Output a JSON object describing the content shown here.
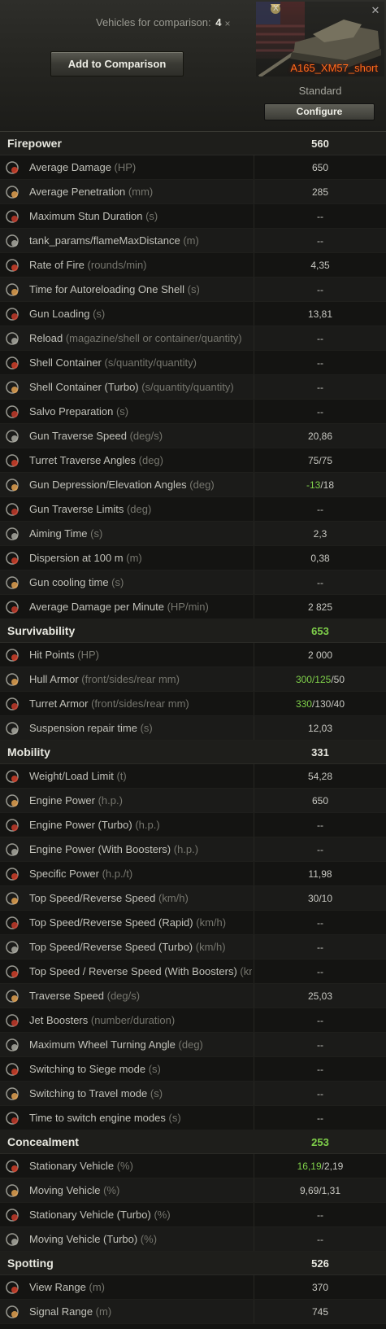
{
  "header": {
    "vehicles_label": "Vehicles for comparison:",
    "vehicles_count": "4",
    "close_symbol": "×",
    "add_button": "Add to Comparison"
  },
  "card": {
    "tier": "X",
    "name": "A165_XM57_short",
    "type": "Standard",
    "configure": "Configure",
    "close_symbol": "✕"
  },
  "colors": {
    "accent_green": "#7fd04a",
    "name_orange": "#ff6a1a"
  },
  "sections": [
    {
      "title": "Firepower",
      "value": "560",
      "value_color": "white",
      "rows": [
        {
          "label": "Average Damage ",
          "unit": "(HP)",
          "value": "650",
          "icon": "average-damage-icon",
          "green": true
        },
        {
          "label": "Average Penetration ",
          "unit": "(mm)",
          "value": "285",
          "icon": "penetration-icon",
          "green": true
        },
        {
          "label": "Maximum Stun Duration ",
          "unit": "(s)",
          "value": "--",
          "icon": "stun-icon"
        },
        {
          "label": "tank_params/flameMaxDistance ",
          "unit": "(m)",
          "value": "--",
          "icon": "flame-distance-icon"
        },
        {
          "label": "Rate of Fire ",
          "unit": "(rounds/min)",
          "value": "4,35",
          "icon": "rate-of-fire-icon"
        },
        {
          "label": "Time for Autoreloading One Shell ",
          "unit": "(s)",
          "value": "--",
          "icon": "autoreload-icon"
        },
        {
          "label": "Gun Loading ",
          "unit": "(s)",
          "value": "13,81",
          "icon": "gun-loading-icon"
        },
        {
          "label": "Reload ",
          "unit": "(magazine/shell or container/quantity)",
          "value": "--",
          "icon": "reload-icon"
        },
        {
          "label": "Shell Container ",
          "unit": "(s/quantity/quantity)",
          "value": "--",
          "icon": "shell-container-icon"
        },
        {
          "label": "Shell Container (Turbo) ",
          "unit": "(s/quantity/quantity)",
          "value": "--",
          "icon": "shell-container-turbo-icon"
        },
        {
          "label": "Salvo Preparation ",
          "unit": "(s)",
          "value": "--",
          "icon": "salvo-icon"
        },
        {
          "label": "Gun Traverse Speed ",
          "unit": "(deg/s)",
          "value": "20,86",
          "icon": "gun-traverse-icon"
        },
        {
          "label": "Turret Traverse Angles ",
          "unit": "(deg)",
          "value": "75/75",
          "icon": "turret-angles-icon",
          "green": true
        },
        {
          "label": "Gun Depression/Elevation Angles ",
          "unit": "(deg)",
          "value_parts": [
            "-13",
            "/18"
          ],
          "icon": "gun-elevation-icon"
        },
        {
          "label": "Gun Traverse Limits ",
          "unit": "(deg)",
          "value": "--",
          "icon": "traverse-limits-icon"
        },
        {
          "label": "Aiming Time ",
          "unit": "(s)",
          "value": "2,3",
          "icon": "aiming-icon"
        },
        {
          "label": "Dispersion at 100 m ",
          "unit": "(m)",
          "value": "0,38",
          "icon": "dispersion-icon"
        },
        {
          "label": "Gun cooling time ",
          "unit": "(s)",
          "value": "--",
          "icon": "gun-cooling-icon"
        },
        {
          "label": "Average Damage per Minute ",
          "unit": "(HP/min)",
          "value": "2 825",
          "icon": "dpm-icon"
        }
      ]
    },
    {
      "title": "Survivability",
      "value": "653",
      "value_color": "green",
      "rows": [
        {
          "label": "Hit Points ",
          "unit": "(HP)",
          "value": "2 000",
          "icon": "hit-points-icon",
          "green": true
        },
        {
          "label": "Hull Armor ",
          "unit": "(front/sides/rear mm)",
          "value_parts": [
            "300/125",
            "/50"
          ],
          "icon": "hull-armor-icon"
        },
        {
          "label": "Turret Armor ",
          "unit": "(front/sides/rear mm)",
          "value_parts": [
            "330",
            "/130/40"
          ],
          "icon": "turret-armor-icon"
        },
        {
          "label": "Suspension repair time ",
          "unit": "(s)",
          "value": "12,03",
          "icon": "suspension-repair-icon",
          "green": true
        }
      ]
    },
    {
      "title": "Mobility",
      "value": "331",
      "value_color": "white",
      "rows": [
        {
          "label": "Weight/Load Limit ",
          "unit": "(t)",
          "value": "54,28",
          "icon": "weight-icon",
          "green": true
        },
        {
          "label": "Engine Power ",
          "unit": "(h.p.)",
          "value": "650",
          "icon": "engine-power-icon"
        },
        {
          "label": "Engine Power (Turbo) ",
          "unit": "(h.p.)",
          "value": "--",
          "icon": "engine-turbo-icon"
        },
        {
          "label": "Engine Power (With Boosters) ",
          "unit": "(h.p.)",
          "value": "--",
          "icon": "engine-boosters-icon"
        },
        {
          "label": "Specific Power ",
          "unit": "(h.p./t)",
          "value": "11,98",
          "icon": "specific-power-icon"
        },
        {
          "label": "Top Speed/Reverse Speed ",
          "unit": "(km/h)",
          "value": "30/10",
          "icon": "top-speed-icon"
        },
        {
          "label": "Top Speed/Reverse Speed (Rapid) ",
          "unit": "(km/h)",
          "value": "--",
          "icon": "speed-rapid-icon"
        },
        {
          "label": "Top Speed/Reverse Speed (Turbo) ",
          "unit": "(km/h)",
          "value": "--",
          "icon": "speed-turbo-icon"
        },
        {
          "label": "Top Speed / Reverse Speed (With Boosters) ",
          "unit": "(km/h)",
          "value": "--",
          "icon": "speed-boosters-icon"
        },
        {
          "label": "Traverse Speed ",
          "unit": "(deg/s)",
          "value": "25,03",
          "icon": "traverse-speed-icon"
        },
        {
          "label": "Jet Boosters ",
          "unit": "(number/duration)",
          "value": "--",
          "icon": "jet-boosters-icon"
        },
        {
          "label": "Maximum Wheel Turning Angle ",
          "unit": "(deg)",
          "value": "--",
          "icon": "wheel-angle-icon"
        },
        {
          "label": "Switching to Siege mode  ",
          "unit": "(s)",
          "value": "--",
          "icon": "siege-mode-icon"
        },
        {
          "label": "Switching to Travel mode  ",
          "unit": "(s)",
          "value": "--",
          "icon": "travel-mode-icon"
        },
        {
          "label": "Time to switch engine modes ",
          "unit": "(s)",
          "value": "--",
          "icon": "engine-modes-icon"
        }
      ]
    },
    {
      "title": "Concealment",
      "value": "253",
      "value_color": "green",
      "rows": [
        {
          "label": "Stationary Vehicle ",
          "unit": "(%)",
          "value_parts": [
            "16,19",
            "/2,19"
          ],
          "icon": "stationary-concealment-icon"
        },
        {
          "label": "Moving Vehicle ",
          "unit": "(%)",
          "value": "9,69/1,31",
          "icon": "moving-concealment-icon"
        },
        {
          "label": "Stationary Vehicle (Turbo) ",
          "unit": "(%)",
          "value": "--",
          "icon": "stationary-turbo-icon"
        },
        {
          "label": "Moving Vehicle (Turbo) ",
          "unit": "(%)",
          "value": "--",
          "icon": "moving-turbo-icon"
        }
      ]
    },
    {
      "title": "Spotting",
      "value": "526",
      "value_color": "white",
      "rows": [
        {
          "label": "View Range ",
          "unit": "(m)",
          "value": "370",
          "icon": "view-range-icon"
        },
        {
          "label": "Signal Range ",
          "unit": "(m)",
          "value": "745",
          "icon": "signal-range-icon"
        }
      ]
    }
  ]
}
